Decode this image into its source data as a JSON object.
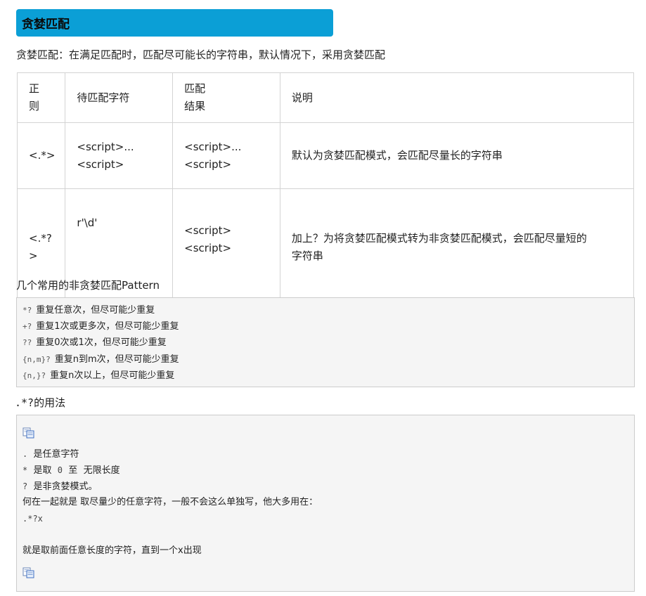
{
  "section": {
    "title": "贪婪匹配"
  },
  "intro": "贪婪匹配：在满足匹配时，匹配尽可能长的字符串，默认情况下，采用贪婪匹配",
  "table": {
    "headers": {
      "regex": [
        "正",
        "则"
      ],
      "input": "待匹配字符",
      "result": [
        "匹配",
        "结果"
      ],
      "desc": "说明"
    },
    "rows": [
      {
        "regex": [
          "<.*>"
        ],
        "input": [
          "<script>...",
          "<script>"
        ],
        "result": [
          "<script>...",
          "<script>"
        ],
        "desc": [
          "默认为贪婪匹配模式，会匹配尽量长的字符串"
        ]
      },
      {
        "regex": [
          "<.*?",
          ">"
        ],
        "input": [
          "r'\\d'"
        ],
        "result": [
          "<script>",
          "<script>"
        ],
        "desc": [
          "加上？为将贪婪匹配模式转为非贪婪匹配模式，会匹配尽量短的",
          "字符串"
        ]
      }
    ]
  },
  "lazy_caption": "几个常用的非贪婪匹配Pattern",
  "lazy_patterns": [
    {
      "token": "*?",
      "text": "重复任意次，但尽可能少重复"
    },
    {
      "token": "+?",
      "text": "重复1次或更多次，但尽可能少重复"
    },
    {
      "token": "??",
      "text": "重复0次或1次，但尽可能少重复"
    },
    {
      "token": "{n,m}?",
      "text": "重复n到m次，但尽可能少重复"
    },
    {
      "token": "{n,}?",
      "text": "重复n次以上，但尽可能少重复"
    }
  ],
  "usage_caption": {
    "token": ".*?",
    "text": "的用法"
  },
  "usage_lines": {
    "dot_token": ".",
    "dot_text": "是任意字符",
    "star_token": "*",
    "star_text": "是取",
    "zero": "0",
    "to": "至",
    "infinite": "无限长度",
    "q_token": "?",
    "q_text": "是非贪婪模式。",
    "together": "何在一起就是 取尽量少的任意字符，一般不会这么单独写，他大多用在：",
    "example": ".*?x",
    "meaning": "就是取前面任意长度的字符，直到一个x出现"
  },
  "icons": {
    "copy": "copy-code-icon"
  },
  "colors": {
    "header_bg": "#0b9fd6",
    "code_bg": "#f5f5f5",
    "border": "#d3d3d3"
  }
}
